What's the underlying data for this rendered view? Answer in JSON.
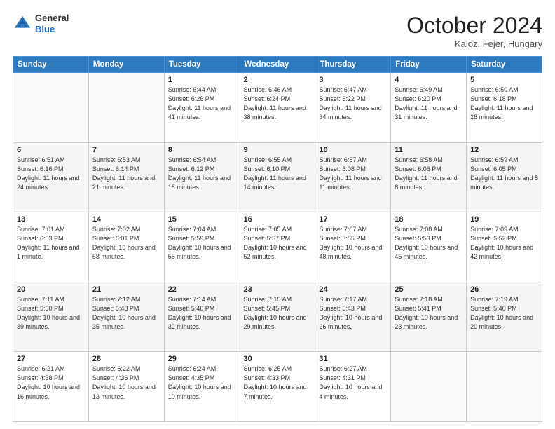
{
  "header": {
    "logo_general": "General",
    "logo_blue": "Blue",
    "month_title": "October 2024",
    "location": "Kaloz, Fejer, Hungary"
  },
  "days_of_week": [
    "Sunday",
    "Monday",
    "Tuesday",
    "Wednesday",
    "Thursday",
    "Friday",
    "Saturday"
  ],
  "weeks": [
    [
      {
        "day": "",
        "content": ""
      },
      {
        "day": "",
        "content": ""
      },
      {
        "day": "1",
        "content": "Sunrise: 6:44 AM\nSunset: 6:26 PM\nDaylight: 11 hours and 41 minutes."
      },
      {
        "day": "2",
        "content": "Sunrise: 6:46 AM\nSunset: 6:24 PM\nDaylight: 11 hours and 38 minutes."
      },
      {
        "day": "3",
        "content": "Sunrise: 6:47 AM\nSunset: 6:22 PM\nDaylight: 11 hours and 34 minutes."
      },
      {
        "day": "4",
        "content": "Sunrise: 6:49 AM\nSunset: 6:20 PM\nDaylight: 11 hours and 31 minutes."
      },
      {
        "day": "5",
        "content": "Sunrise: 6:50 AM\nSunset: 6:18 PM\nDaylight: 11 hours and 28 minutes."
      }
    ],
    [
      {
        "day": "6",
        "content": "Sunrise: 6:51 AM\nSunset: 6:16 PM\nDaylight: 11 hours and 24 minutes."
      },
      {
        "day": "7",
        "content": "Sunrise: 6:53 AM\nSunset: 6:14 PM\nDaylight: 11 hours and 21 minutes."
      },
      {
        "day": "8",
        "content": "Sunrise: 6:54 AM\nSunset: 6:12 PM\nDaylight: 11 hours and 18 minutes."
      },
      {
        "day": "9",
        "content": "Sunrise: 6:55 AM\nSunset: 6:10 PM\nDaylight: 11 hours and 14 minutes."
      },
      {
        "day": "10",
        "content": "Sunrise: 6:57 AM\nSunset: 6:08 PM\nDaylight: 11 hours and 11 minutes."
      },
      {
        "day": "11",
        "content": "Sunrise: 6:58 AM\nSunset: 6:06 PM\nDaylight: 11 hours and 8 minutes."
      },
      {
        "day": "12",
        "content": "Sunrise: 6:59 AM\nSunset: 6:05 PM\nDaylight: 11 hours and 5 minutes."
      }
    ],
    [
      {
        "day": "13",
        "content": "Sunrise: 7:01 AM\nSunset: 6:03 PM\nDaylight: 11 hours and 1 minute."
      },
      {
        "day": "14",
        "content": "Sunrise: 7:02 AM\nSunset: 6:01 PM\nDaylight: 10 hours and 58 minutes."
      },
      {
        "day": "15",
        "content": "Sunrise: 7:04 AM\nSunset: 5:59 PM\nDaylight: 10 hours and 55 minutes."
      },
      {
        "day": "16",
        "content": "Sunrise: 7:05 AM\nSunset: 5:57 PM\nDaylight: 10 hours and 52 minutes."
      },
      {
        "day": "17",
        "content": "Sunrise: 7:07 AM\nSunset: 5:55 PM\nDaylight: 10 hours and 48 minutes."
      },
      {
        "day": "18",
        "content": "Sunrise: 7:08 AM\nSunset: 5:53 PM\nDaylight: 10 hours and 45 minutes."
      },
      {
        "day": "19",
        "content": "Sunrise: 7:09 AM\nSunset: 5:52 PM\nDaylight: 10 hours and 42 minutes."
      }
    ],
    [
      {
        "day": "20",
        "content": "Sunrise: 7:11 AM\nSunset: 5:50 PM\nDaylight: 10 hours and 39 minutes."
      },
      {
        "day": "21",
        "content": "Sunrise: 7:12 AM\nSunset: 5:48 PM\nDaylight: 10 hours and 35 minutes."
      },
      {
        "day": "22",
        "content": "Sunrise: 7:14 AM\nSunset: 5:46 PM\nDaylight: 10 hours and 32 minutes."
      },
      {
        "day": "23",
        "content": "Sunrise: 7:15 AM\nSunset: 5:45 PM\nDaylight: 10 hours and 29 minutes."
      },
      {
        "day": "24",
        "content": "Sunrise: 7:17 AM\nSunset: 5:43 PM\nDaylight: 10 hours and 26 minutes."
      },
      {
        "day": "25",
        "content": "Sunrise: 7:18 AM\nSunset: 5:41 PM\nDaylight: 10 hours and 23 minutes."
      },
      {
        "day": "26",
        "content": "Sunrise: 7:19 AM\nSunset: 5:40 PM\nDaylight: 10 hours and 20 minutes."
      }
    ],
    [
      {
        "day": "27",
        "content": "Sunrise: 6:21 AM\nSunset: 4:38 PM\nDaylight: 10 hours and 16 minutes."
      },
      {
        "day": "28",
        "content": "Sunrise: 6:22 AM\nSunset: 4:36 PM\nDaylight: 10 hours and 13 minutes."
      },
      {
        "day": "29",
        "content": "Sunrise: 6:24 AM\nSunset: 4:35 PM\nDaylight: 10 hours and 10 minutes."
      },
      {
        "day": "30",
        "content": "Sunrise: 6:25 AM\nSunset: 4:33 PM\nDaylight: 10 hours and 7 minutes."
      },
      {
        "day": "31",
        "content": "Sunrise: 6:27 AM\nSunset: 4:31 PM\nDaylight: 10 hours and 4 minutes."
      },
      {
        "day": "",
        "content": ""
      },
      {
        "day": "",
        "content": ""
      }
    ]
  ]
}
